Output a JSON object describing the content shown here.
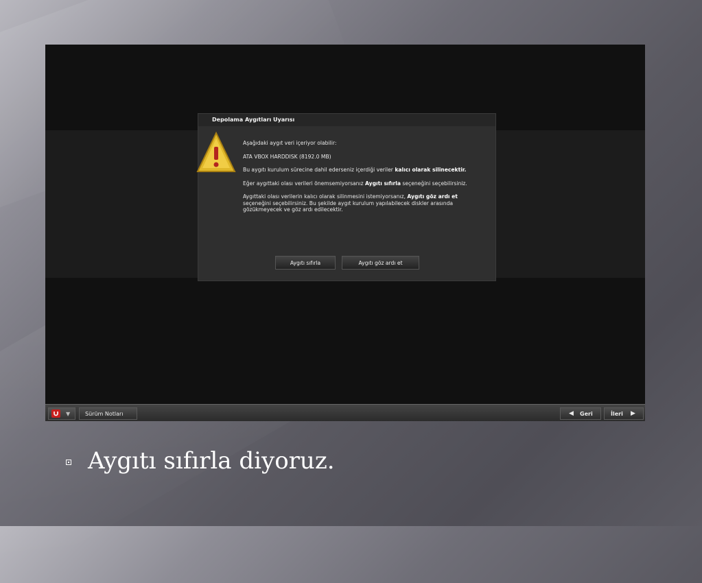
{
  "dialog": {
    "title": "Depolama Aygıtları Uyarısı",
    "line1": "Aşağıdaki aygıt veri içeriyor olabilir:",
    "device": "ATA VBOX HARDDISK (8192.0 MB)",
    "line3_pre": "Bu aygıtı kurulum sürecine dahil ederseniz içerdiği veriler ",
    "line3_bold": "kalıcı olarak silinecektir.",
    "line4_pre": "Eğer aygıttaki olası verileri önemsemiyorsanız ",
    "line4_bold": "Aygıtı sıfırla",
    "line4_post": " seçeneğini seçebilirsiniz.",
    "line5_pre": "Aygıttaki olası verilerin kalıcı olarak silinmesini istemiyorsanız, ",
    "line5_bold": "Aygıtı göz ardı et",
    "line5_post": " seçeneğini seçebilirsiniz. Bu şekilde aygıt kurulum yapılabilecek diskler arasında gözükmeyecek ve göz ardı edilecektir.",
    "btn_reset": "Aygıtı sıfırla",
    "btn_ignore": "Aygıtı göz ardı et"
  },
  "taskbar": {
    "release_notes": "Sürüm Notları",
    "back": "Geri",
    "next": "İleri"
  },
  "caption": "Aygıtı sıfırla diyoruz.",
  "colors": {
    "warning": "#e0b82a",
    "brand_red": "#c8201e"
  }
}
